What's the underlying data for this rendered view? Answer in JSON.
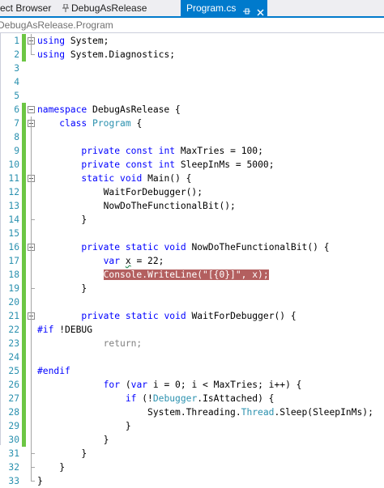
{
  "tabs": [
    {
      "label": "ect Browser"
    },
    {
      "label": "DebugAsRelease"
    },
    {
      "label": "Program.cs",
      "active": true
    }
  ],
  "tab_icons": [
    "pin-icon",
    "pin-active-icon",
    "close-icon"
  ],
  "navbar": {
    "text": "DebugAsRelease.Program"
  },
  "colors": {
    "keyword": "#0000ff",
    "type": "#2b91af",
    "string": "#a31515",
    "disabled": "#808080",
    "breakpoint_highlight": "#b35f5f",
    "change_bar": "#6cc644",
    "accent": "#007acc"
  },
  "lines": [
    {
      "n": "1",
      "tokens": [
        [
          "kw",
          "using"
        ],
        [
          "p",
          " System;"
        ]
      ]
    },
    {
      "n": "2",
      "tokens": [
        [
          "kw",
          "using"
        ],
        [
          "p",
          " System.Diagnostics;"
        ]
      ]
    },
    {
      "n": "3",
      "tokens": []
    },
    {
      "n": "4",
      "tokens": []
    },
    {
      "n": "5",
      "tokens": []
    },
    {
      "n": "6",
      "tokens": [
        [
          "kw",
          "namespace"
        ],
        [
          "p",
          " DebugAsRelease {"
        ]
      ]
    },
    {
      "n": "7",
      "tokens": [
        [
          "p",
          "    "
        ],
        [
          "kw",
          "class"
        ],
        [
          "p",
          " "
        ],
        [
          "ty",
          "Program"
        ],
        [
          "p",
          " {"
        ]
      ]
    },
    {
      "n": "8",
      "tokens": []
    },
    {
      "n": "9",
      "tokens": [
        [
          "p",
          "        "
        ],
        [
          "kw",
          "private"
        ],
        [
          "p",
          " "
        ],
        [
          "kw",
          "const"
        ],
        [
          "p",
          " "
        ],
        [
          "kw",
          "int"
        ],
        [
          "p",
          " MaxTries = 100;"
        ]
      ]
    },
    {
      "n": "10",
      "tokens": [
        [
          "p",
          "        "
        ],
        [
          "kw",
          "private"
        ],
        [
          "p",
          " "
        ],
        [
          "kw",
          "const"
        ],
        [
          "p",
          " "
        ],
        [
          "kw",
          "int"
        ],
        [
          "p",
          " SleepInMs = 5000;"
        ]
      ]
    },
    {
      "n": "11",
      "tokens": [
        [
          "p",
          "        "
        ],
        [
          "kw",
          "static"
        ],
        [
          "p",
          " "
        ],
        [
          "kw",
          "void"
        ],
        [
          "p",
          " Main() {"
        ]
      ]
    },
    {
      "n": "12",
      "tokens": [
        [
          "p",
          "            WaitForDebugger();"
        ]
      ]
    },
    {
      "n": "13",
      "tokens": [
        [
          "p",
          "            NowDoTheFunctionalBit();"
        ]
      ]
    },
    {
      "n": "14",
      "tokens": [
        [
          "p",
          "        }"
        ]
      ]
    },
    {
      "n": "15",
      "tokens": []
    },
    {
      "n": "16",
      "tokens": [
        [
          "p",
          "        "
        ],
        [
          "kw",
          "private"
        ],
        [
          "p",
          " "
        ],
        [
          "kw",
          "static"
        ],
        [
          "p",
          " "
        ],
        [
          "kw",
          "void"
        ],
        [
          "p",
          " NowDoTheFunctionalBit() {"
        ]
      ]
    },
    {
      "n": "17",
      "tokens": [
        [
          "p",
          "            "
        ],
        [
          "kw",
          "var"
        ],
        [
          "p",
          " "
        ],
        [
          "wv",
          "x"
        ],
        [
          "p",
          " = 22;"
        ]
      ]
    },
    {
      "n": "18",
      "tokens": [
        [
          "p",
          "            "
        ],
        [
          "hl",
          "Console.WriteLine(\"[{0}]\", x);"
        ]
      ]
    },
    {
      "n": "19",
      "tokens": [
        [
          "p",
          "        }"
        ]
      ]
    },
    {
      "n": "20",
      "tokens": []
    },
    {
      "n": "21",
      "tokens": [
        [
          "p",
          "        "
        ],
        [
          "kw",
          "private"
        ],
        [
          "p",
          " "
        ],
        [
          "kw",
          "static"
        ],
        [
          "p",
          " "
        ],
        [
          "kw",
          "void"
        ],
        [
          "p",
          " WaitForDebugger() {"
        ]
      ]
    },
    {
      "n": "22",
      "tokens": [
        [
          "kw",
          "#if"
        ],
        [
          "p",
          " !DEBUG"
        ]
      ]
    },
    {
      "n": "23",
      "tokens": [
        [
          "p",
          "            "
        ],
        [
          "dis",
          "return;"
        ]
      ]
    },
    {
      "n": "24",
      "tokens": []
    },
    {
      "n": "25",
      "tokens": [
        [
          "kw",
          "#endif"
        ]
      ]
    },
    {
      "n": "26",
      "tokens": [
        [
          "p",
          "            "
        ],
        [
          "kw",
          "for"
        ],
        [
          "p",
          " ("
        ],
        [
          "kw",
          "var"
        ],
        [
          "p",
          " i = 0; i < MaxTries; i++) {"
        ]
      ]
    },
    {
      "n": "27",
      "tokens": [
        [
          "p",
          "                "
        ],
        [
          "kw",
          "if"
        ],
        [
          "p",
          " (!"
        ],
        [
          "ty",
          "Debugger"
        ],
        [
          "p",
          ".IsAttached) {"
        ]
      ]
    },
    {
      "n": "28",
      "tokens": [
        [
          "p",
          "                    System.Threading."
        ],
        [
          "ty",
          "Thread"
        ],
        [
          "p",
          ".Sleep(SleepInMs);"
        ]
      ]
    },
    {
      "n": "29",
      "tokens": [
        [
          "p",
          "                }"
        ]
      ]
    },
    {
      "n": "30",
      "tokens": [
        [
          "p",
          "            }"
        ]
      ]
    },
    {
      "n": "31",
      "tokens": [
        [
          "p",
          "        }"
        ]
      ]
    },
    {
      "n": "32",
      "tokens": [
        [
          "p",
          "    }"
        ]
      ]
    },
    {
      "n": "33",
      "tokens": [
        [
          "p",
          "}"
        ]
      ]
    }
  ]
}
